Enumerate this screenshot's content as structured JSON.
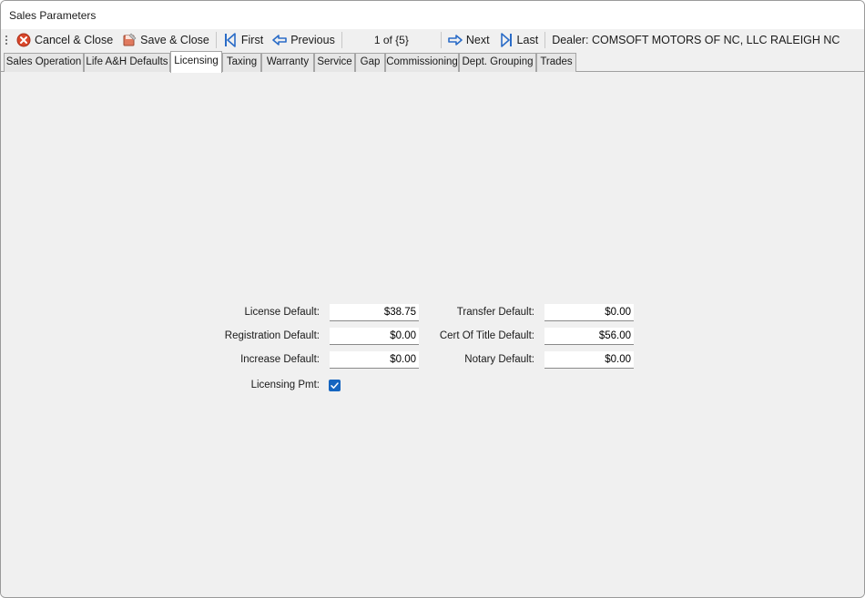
{
  "window": {
    "title": "Sales Parameters"
  },
  "toolbar": {
    "cancel_close": "Cancel & Close",
    "save_close": "Save & Close",
    "first": "First",
    "previous": "Previous",
    "counter": "1 of {5}",
    "next": "Next",
    "last": "Last",
    "dealer": "Dealer: COMSOFT MOTORS OF NC, LLC RALEIGH NC"
  },
  "tabs": [
    {
      "label": "Sales Operation"
    },
    {
      "label": "Life A&H Defaults"
    },
    {
      "label": "Licensing"
    },
    {
      "label": "Taxing"
    },
    {
      "label": "Warranty"
    },
    {
      "label": "Service"
    },
    {
      "label": "Gap"
    },
    {
      "label": "Commissioning"
    },
    {
      "label": "Dept. Grouping"
    },
    {
      "label": "Trades"
    }
  ],
  "active_tab": "Licensing",
  "form": {
    "license_default": {
      "label": "License Default:",
      "value": "$38.75"
    },
    "registration_default": {
      "label": "Registration Default:",
      "value": "$0.00"
    },
    "increase_default": {
      "label": "Increase Default:",
      "value": "$0.00"
    },
    "licensing_pmt": {
      "label": "Licensing Pmt:",
      "checked": true
    },
    "transfer_default": {
      "label": "Transfer Default:",
      "value": "$0.00"
    },
    "cert_of_title_default": {
      "label": "Cert Of Title Default:",
      "value": "$56.00"
    },
    "notary_default": {
      "label": "Notary Default:",
      "value": "$0.00"
    }
  },
  "colors": {
    "accent": "#1565c0",
    "cancel": "#d9472b",
    "nav_arrow": "#2a6cc7"
  }
}
